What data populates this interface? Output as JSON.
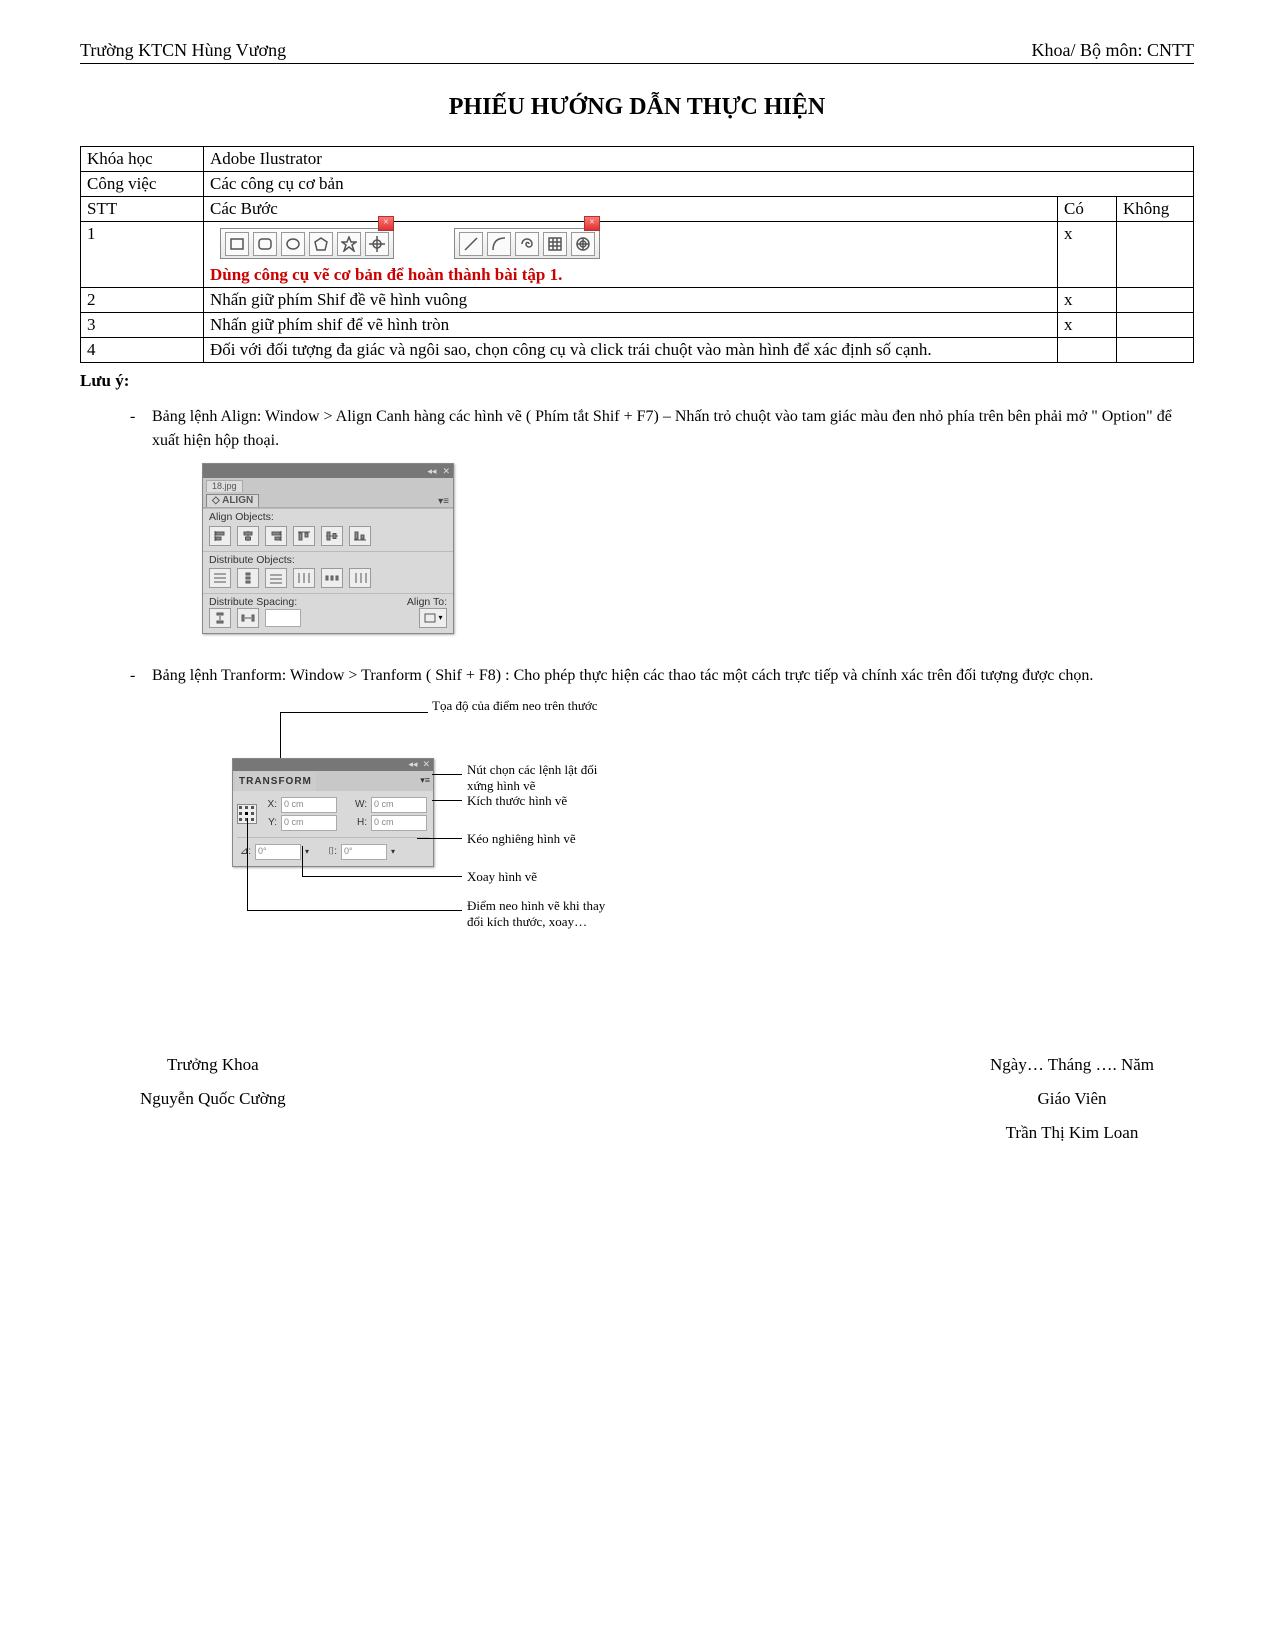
{
  "header": {
    "left": "Trường KTCN Hùng Vương",
    "right": "Khoa/ Bộ môn: CNTT"
  },
  "title": "PHIẾU HƯỚNG DẪN THỰC HIỆN",
  "meta": {
    "course_label": "Khóa học",
    "course_value": "Adobe Ilustrator",
    "task_label": "Công việc",
    "task_value": "Các công cụ cơ bản"
  },
  "columns": {
    "stt": "STT",
    "steps": "Các Bước",
    "yes": "Có",
    "no": "Không"
  },
  "rows": [
    {
      "stt": "1",
      "extra_text": "Dùng công cụ vẽ cơ bản để hoàn thành bài tập 1.",
      "yes": "x",
      "no": ""
    },
    {
      "stt": "2",
      "text": "Nhấn giữ phím  Shif đề vẽ hình vuông",
      "yes": "x",
      "no": ""
    },
    {
      "stt": "3",
      "text": "Nhấn giữ phím shif để vẽ hình tròn",
      "yes": "x",
      "no": ""
    },
    {
      "stt": "4",
      "text": "Đối với đối tượng đa giác và ngôi sao, chọn công cụ và click trái chuột vào màn hình để xác định số cạnh.",
      "yes": "",
      "no": ""
    }
  ],
  "note_label": "Lưu ý:",
  "notes": [
    "Bảng lệnh Align: Window > Align Canh hàng các hình vẽ  ( Phím tắt Shif + F7) – Nhấn trỏ chuột vào tam giác màu đen  nhỏ phía trên bên phải mở \" Option\" để xuất hiện hộp thoại.",
    "Bảng lệnh Tranform: Window > Tranform  ( Shif + F8) : Cho phép thực hiện các thao tác một cách trực tiếp và chính xác trên đối tượng được chọn."
  ],
  "align_panel": {
    "tab_small": "18.jpg",
    "tab": "◇ ALIGN",
    "s1": "Align Objects:",
    "s2": "Distribute Objects:",
    "s3": "Distribute Spacing:",
    "s3b": "Align To:"
  },
  "transform_panel": {
    "tab": "TRANSFORM",
    "x_lbl": "X:",
    "x_val": "0 cm",
    "y_lbl": "Y:",
    "y_val": "0 cm",
    "w_lbl": "W:",
    "w_val": "0 cm",
    "h_lbl": "H:",
    "h_val": "0 cm",
    "ang_lbl": "⊿:",
    "ang_val": "0°",
    "shear_lbl": "⌷:",
    "shear_val": "0°"
  },
  "annotations": {
    "a1": "Tọa độ của điểm neo trên thước",
    "a2": "Nút chọn các lệnh lật đối xứng hình vẽ",
    "a3": "Kích thước hình vẽ",
    "a4": "Kéo nghiêng hình vẽ",
    "a5": "Xoay hình vẽ",
    "a6": "Điểm neo hình vẽ khi thay đổi kích thước, xoay…"
  },
  "sig": {
    "left1": "Trưởng Khoa",
    "left2": "Nguyễn Quốc Cường",
    "right1": "Ngày… Tháng …. Năm",
    "right2": "Giáo Viên",
    "right3": "Trần Thị Kim Loan"
  }
}
